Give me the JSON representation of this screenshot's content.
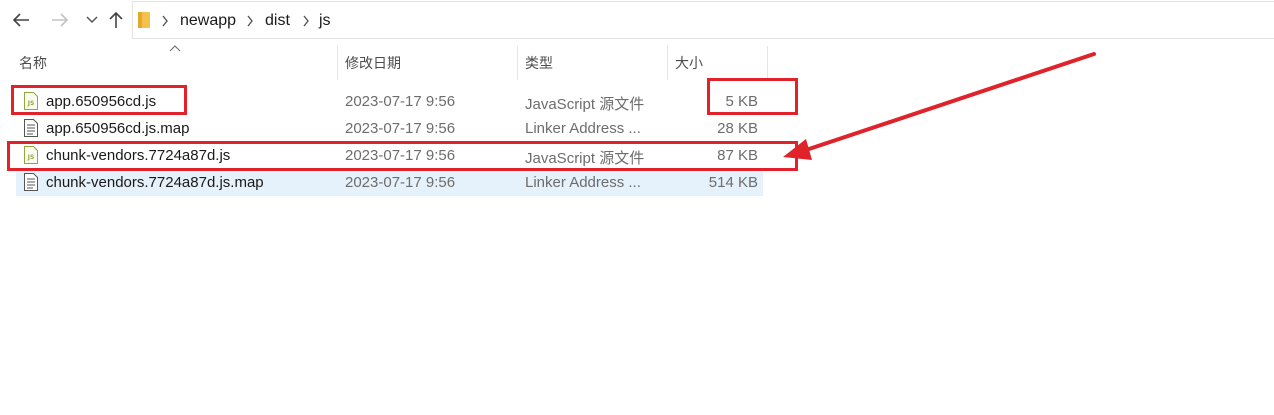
{
  "nav": {
    "back_icon": "arrow-left-icon",
    "forward_icon": "arrow-right-icon",
    "recent_icon": "chevron-down-icon",
    "up_icon": "arrow-up-icon"
  },
  "breadcrumb": {
    "folder_icon": "folder-icon",
    "items": [
      "newapp",
      "dist",
      "js"
    ]
  },
  "columns": {
    "name": "名称",
    "modified": "修改日期",
    "type": "类型",
    "size": "大小"
  },
  "files": [
    {
      "name": "app.650956cd.js",
      "modified": "2023-07-17 9:56",
      "type": "JavaScript 源文件",
      "size": "5 KB",
      "icon": "js-file-icon"
    },
    {
      "name": "app.650956cd.js.map",
      "modified": "2023-07-17 9:56",
      "type": "Linker Address ...",
      "size": "28 KB",
      "icon": "text-file-icon"
    },
    {
      "name": "chunk-vendors.7724a87d.js",
      "modified": "2023-07-17 9:56",
      "type": "JavaScript 源文件",
      "size": "87 KB",
      "icon": "js-file-icon"
    },
    {
      "name": "chunk-vendors.7724a87d.js.map",
      "modified": "2023-07-17 9:56",
      "type": "Linker Address ...",
      "size": "514 KB",
      "icon": "text-file-icon",
      "selected": true
    }
  ],
  "colors": {
    "annotation": "#e0222b",
    "selection": "#e5f1fb",
    "folder": "#f2c14e",
    "js_icon": "#8fa83a"
  }
}
